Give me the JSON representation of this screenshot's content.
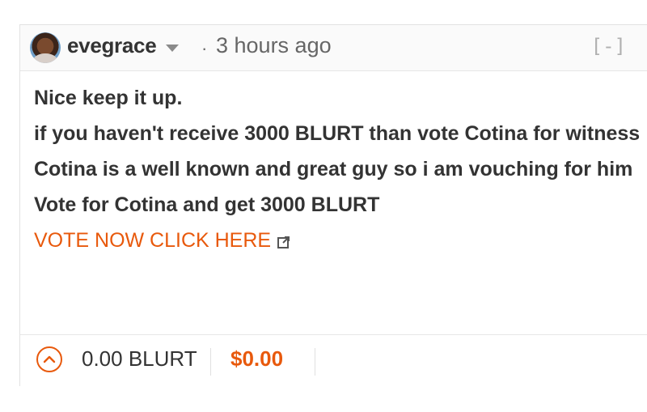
{
  "comment": {
    "author": "evegrace",
    "separator": "·",
    "time": "3 hours ago",
    "collapse_label": "[-]",
    "lines": [
      "Nice keep it up.",
      "if you haven't receive 3000 BLURT than vote Cotina for witness",
      "Cotina is a well known and great guy so i am vouching for him",
      "Vote for Cotina and get 3000 BLURT"
    ],
    "link_text": "VOTE NOW CLICK HERE"
  },
  "footer": {
    "payout": "0.00 BLURT",
    "usd_value": "$0.00"
  },
  "icons": {
    "avatar": "user-avatar",
    "caret": "chevron-down-icon",
    "upvote": "chevron-up-icon",
    "external": "external-link-icon"
  },
  "colors": {
    "accent": "#e8590c",
    "text": "#333333",
    "muted": "#666666"
  }
}
